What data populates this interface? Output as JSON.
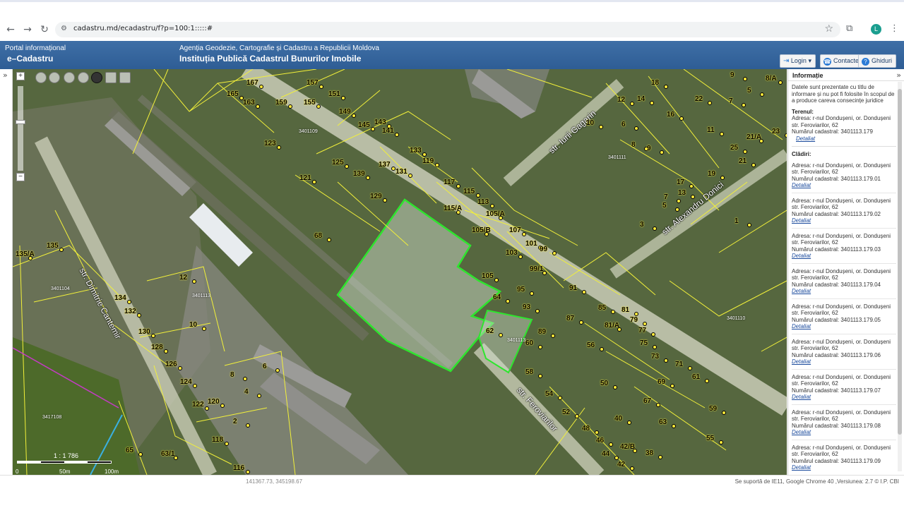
{
  "browser": {
    "url": "cadastru.md/ecadastru/f?p=100:1:::::#",
    "avatar_letter": "L",
    "icons": [
      "back-icon",
      "forward-icon",
      "reload-icon",
      "site-settings-icon",
      "bookmark-star-icon",
      "extensions-icon",
      "menu-icon"
    ]
  },
  "header": {
    "portal_line": "Portal informațional",
    "portal_name": "e–Cadastru",
    "agency": "Agenția Geodezie, Cartografie și Cadastru a Republicii Moldova",
    "institution": "Instituția Publică Cadastrul Bunurilor Imobile",
    "buttons": {
      "login": "Login",
      "contacts": "Contacte",
      "guides": "Ghiduri"
    },
    "color": "#3f6fa6"
  },
  "map": {
    "scale": "1 : 1 786",
    "scale_ticks": [
      "0",
      "50m",
      "100m"
    ],
    "streets": [
      "str. Iurii Gagarin",
      "str. Alexandru Donici",
      "str. Dimitrie Cantemir",
      "str. Feroviarilor"
    ],
    "cadastral_zones": [
      "3401109",
      "3401111",
      "3401104",
      "3401113",
      "3401110",
      "3417108",
      "3401113"
    ],
    "parcel_labels": [
      {
        "t": "167"
      },
      {
        "t": "165"
      },
      {
        "t": "163"
      },
      {
        "t": "159"
      },
      {
        "t": "157"
      },
      {
        "t": "155"
      },
      {
        "t": "151"
      },
      {
        "t": "149"
      },
      {
        "t": "145"
      },
      {
        "t": "143"
      },
      {
        "t": "141"
      },
      {
        "t": "133"
      },
      {
        "t": "131"
      },
      {
        "t": "137"
      },
      {
        "t": "139"
      },
      {
        "t": "125"
      },
      {
        "t": "123"
      },
      {
        "t": "121"
      },
      {
        "t": "119"
      },
      {
        "t": "117"
      },
      {
        "t": "115"
      },
      {
        "t": "113"
      },
      {
        "t": "115/A"
      },
      {
        "t": "105/A"
      },
      {
        "t": "105/B"
      },
      {
        "t": "129"
      },
      {
        "t": "107"
      },
      {
        "t": "101"
      },
      {
        "t": "103"
      },
      {
        "t": "99"
      },
      {
        "t": "99/1"
      },
      {
        "t": "105"
      },
      {
        "t": "95"
      },
      {
        "t": "93"
      },
      {
        "t": "64"
      },
      {
        "t": "62"
      },
      {
        "t": "60"
      },
      {
        "t": "89"
      },
      {
        "t": "87"
      },
      {
        "t": "91"
      },
      {
        "t": "85"
      },
      {
        "t": "81"
      },
      {
        "t": "79"
      },
      {
        "t": "81/A"
      },
      {
        "t": "77"
      },
      {
        "t": "75"
      },
      {
        "t": "73"
      },
      {
        "t": "71"
      },
      {
        "t": "69"
      },
      {
        "t": "67"
      },
      {
        "t": "63"
      },
      {
        "t": "61"
      },
      {
        "t": "59"
      },
      {
        "t": "58"
      },
      {
        "t": "56"
      },
      {
        "t": "54"
      },
      {
        "t": "52"
      },
      {
        "t": "50"
      },
      {
        "t": "48"
      },
      {
        "t": "46"
      },
      {
        "t": "44"
      },
      {
        "t": "42"
      },
      {
        "t": "42/B"
      },
      {
        "t": "40"
      },
      {
        "t": "38"
      },
      {
        "t": "55"
      },
      {
        "t": "68"
      },
      {
        "t": "135"
      },
      {
        "t": "135/A"
      },
      {
        "t": "134"
      },
      {
        "t": "132"
      },
      {
        "t": "130"
      },
      {
        "t": "128"
      },
      {
        "t": "126"
      },
      {
        "t": "124"
      },
      {
        "t": "122"
      },
      {
        "t": "120"
      },
      {
        "t": "118"
      },
      {
        "t": "116"
      },
      {
        "t": "65"
      },
      {
        "t": "63/1"
      },
      {
        "t": "12"
      },
      {
        "t": "10"
      },
      {
        "t": "8"
      },
      {
        "t": "6"
      },
      {
        "t": "4"
      },
      {
        "t": "2"
      },
      {
        "t": "9"
      },
      {
        "t": "8/A"
      },
      {
        "t": "5"
      },
      {
        "t": "7"
      },
      {
        "t": "18"
      },
      {
        "t": "22"
      },
      {
        "t": "12"
      },
      {
        "t": "14"
      },
      {
        "t": "16"
      },
      {
        "t": "10"
      },
      {
        "t": "6"
      },
      {
        "t": "8"
      },
      {
        "t": "9"
      },
      {
        "t": "11"
      },
      {
        "t": "21/A"
      },
      {
        "t": "23"
      },
      {
        "t": "25"
      },
      {
        "t": "21"
      },
      {
        "t": "19"
      },
      {
        "t": "17"
      },
      {
        "t": "13"
      },
      {
        "t": "7"
      },
      {
        "t": "5"
      },
      {
        "t": "3"
      },
      {
        "t": "1"
      },
      {
        "t": "6"
      }
    ]
  },
  "panel": {
    "title": "Informație",
    "disclaimer": "Datele sunt prezentate cu titlu de informare și nu pot fi folosite în scopul de a produce careva consecințe juridice",
    "land_heading": "Terenul:",
    "land_address_1": "Adresa: r-nul Dondușeni, or. Dondușeni",
    "land_address_2": "str. Feroviarilor, 62",
    "land_cad": "Numărul cadastral: 3401113.179",
    "detail_link": "Detaliat",
    "buildings_heading": "Clădiri:",
    "buildings": [
      {
        "a1": "Adresa: r-nul Dondușeni, or. Dondușeni",
        "a2": "str. Feroviarilor, 62",
        "cad": "Numărul cadastral: 3401113.179.01",
        "link": "Detaliat"
      },
      {
        "a1": "Adresa: r-nul Dondușeni, or. Dondușeni",
        "a2": "str. Feroviarilor, 62",
        "cad": "Numărul cadastral: 3401113.179.02",
        "link": "Detaliat"
      },
      {
        "a1": "Adresa: r-nul Dondușeni, or. Dondușeni",
        "a2": "str. Feroviarilor, 62",
        "cad": "Numărul cadastral: 3401113.179.03",
        "link": "Detaliat"
      },
      {
        "a1": "Adresa: r-nul Dondușeni, or. Dondușeni",
        "a2": "str. Feroviarilor, 62",
        "cad": "Numărul cadastral: 3401113.179.04",
        "link": "Detaliat"
      },
      {
        "a1": "Adresa: r-nul Dondușeni, or. Dondușeni",
        "a2": "str. Feroviarilor, 62",
        "cad": "Numărul cadastral: 3401113.179.05",
        "link": "Detaliat"
      },
      {
        "a1": "Adresa: r-nul Dondușeni, or. Dondușeni",
        "a2": "str. Feroviarilor, 62",
        "cad": "Numărul cadastral: 3401113.179.06",
        "link": "Detaliat"
      },
      {
        "a1": "Adresa: r-nul Dondușeni, or. Dondușeni",
        "a2": "str. Feroviarilor, 62",
        "cad": "Numărul cadastral: 3401113.179.07",
        "link": "Detaliat"
      },
      {
        "a1": "Adresa: r-nul Dondușeni, or. Dondușeni",
        "a2": "str. Feroviarilor, 62",
        "cad": "Numărul cadastral: 3401113.179.08",
        "link": "Detaliat"
      },
      {
        "a1": "Adresa: r-nul Dondușeni, or. Dondușeni",
        "a2": "str. Feroviarilor, 62",
        "cad": "Numărul cadastral: 3401113.179.09",
        "link": "Detaliat"
      }
    ]
  },
  "footer": {
    "coords": "141367.73, 345198.67",
    "support": "Se suportă de IE11, Google Chrome 40 ,Versiunea: 2.7 © I.P. CBI"
  }
}
